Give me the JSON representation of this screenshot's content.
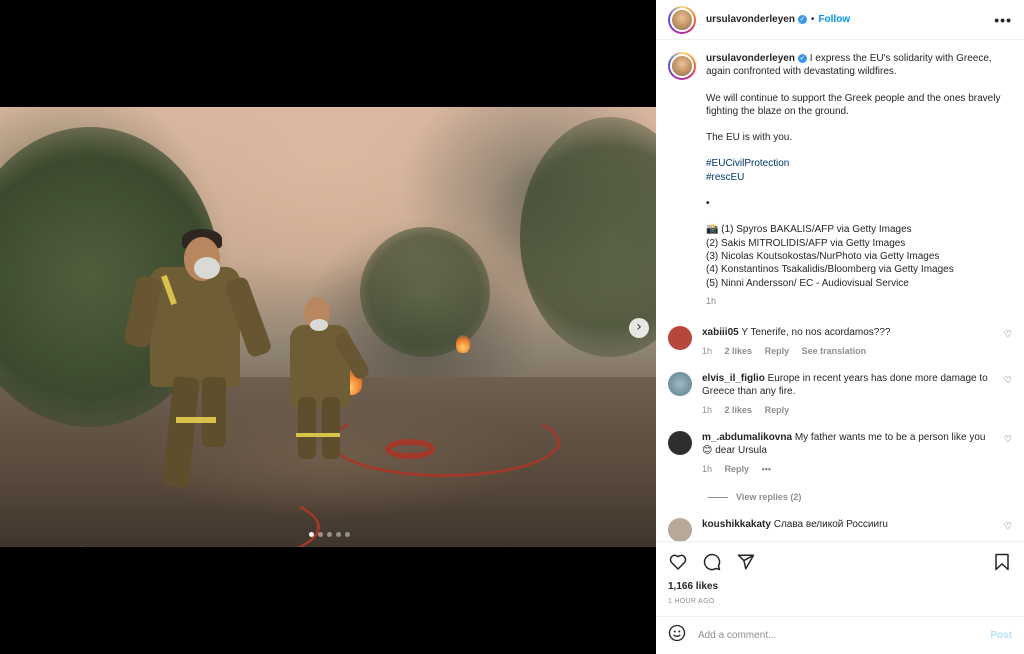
{
  "post": {
    "username": "ursulavonderleyen",
    "follow_label": "Follow",
    "separator": "•",
    "more_label": "•••",
    "verified_glyph": "✓"
  },
  "caption": {
    "username": "ursulavonderleyen",
    "line1": "I express the EU's solidarity with Greece, again confronted with devastating wildfires.",
    "line2": "We will continue to support the Greek people and the ones bravely fighting the blaze on the ground.",
    "line3": "The EU is with you.",
    "tag1": "#EUCivilProtection",
    "tag2": "#rescEU",
    "bullet": "•",
    "credits": [
      "📸 (1) Spyros BAKALIS/AFP via Getty Images",
      "(2) Sakis MITROLIDIS/AFP via Getty Images",
      "(3) Nicolas Koutsokostas/NurPhoto via Getty Images",
      "(4) Konstantinos Tsakalidis/Bloomberg via Getty Images",
      "(5) Ninni Andersson/ EC - Audiovisual Service"
    ],
    "time": "1h"
  },
  "comments": [
    {
      "user": "xabiii05",
      "text": "Y Tenerife, no nos acordamos???",
      "time": "1h",
      "likes": "2 likes",
      "reply": "Reply",
      "extra": "See translation",
      "avatar_color": "#b6473a"
    },
    {
      "user": "elvis_il_figlio",
      "text": "Europe in recent years has done more damage to Greece than any fire.",
      "time": "1h",
      "likes": "2 likes",
      "reply": "Reply",
      "extra": "",
      "avatar_color": "#6d8a9a"
    },
    {
      "user": "m_.abdumalikovna",
      "text": "My father wants me to be a person like you 😊 dear Ursula",
      "time": "1h",
      "likes": "",
      "reply": "Reply",
      "extra": "•••",
      "avatar_color": "#2f2f2f"
    },
    {
      "user": "koushikkakaty",
      "text": "Слава великой Россииru",
      "time": "",
      "likes": "",
      "reply": "",
      "extra": "",
      "avatar_color": "#b8a89a"
    }
  ],
  "view_replies": "View replies (2)",
  "likes_count": "1,166 likes",
  "time_ago": "1 HOUR AGO",
  "comment_input": {
    "placeholder": "Add a comment...",
    "post_label": "Post"
  },
  "carousel": {
    "next_glyph": "›",
    "slides": 5,
    "active": 1
  },
  "colors": {
    "link": "#0095f6",
    "hashtag": "#00376b",
    "muted": "#8e8e8e",
    "hose": "#a2382a"
  },
  "icons": [
    "verified-icon",
    "more-icon",
    "heart-icon",
    "comment-icon",
    "share-icon",
    "bookmark-icon",
    "emoji-icon",
    "chevron-right-icon"
  ]
}
